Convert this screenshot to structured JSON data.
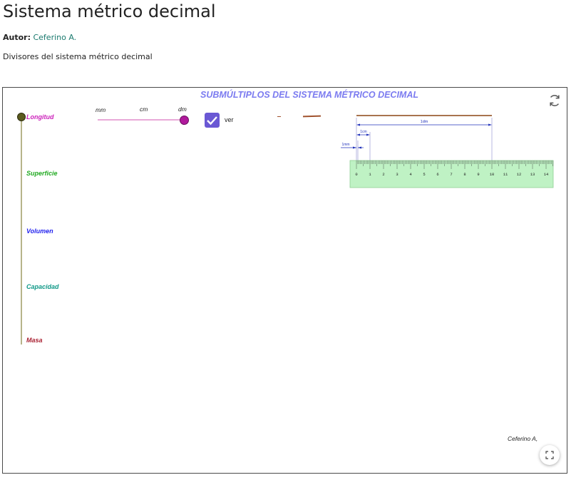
{
  "page": {
    "title": "Sistema métrico decimal",
    "author_label": "Autor:",
    "author_name": "Ceferino A.",
    "description": "Divisores del sistema métrico decimal"
  },
  "applet": {
    "heading": "SUBMÚLTIPLOS DEL SISTEMA MÉTRICO DECIMAL",
    "categories": [
      "Longitud",
      "Superficie",
      "Volumen",
      "Capacidad",
      "Masa"
    ],
    "selected_category": "Longitud",
    "slider": {
      "labels": [
        "mm",
        "cm",
        "dm"
      ],
      "selected": "dm"
    },
    "checkbox": {
      "label": "ver",
      "checked": true
    },
    "ruler": {
      "dim_labels": {
        "dm": "1dm",
        "cm": "1cm",
        "mm": "1mm"
      },
      "scale_labels": [
        "0",
        "1",
        "2",
        "3",
        "4",
        "5",
        "6",
        "7",
        "8",
        "9",
        "10",
        "11",
        "12",
        "13",
        "14"
      ]
    },
    "signature": "Ceferino A,",
    "icons": {
      "refresh": "refresh-icon",
      "fullscreen": "fullscreen-icon",
      "check": "check-icon"
    },
    "colors": {
      "longitud": "#cc22bb",
      "superficie": "#22aa22",
      "volumen": "#2222ee",
      "capacidad": "#119988",
      "masa": "#aa2233",
      "heading": "#7b7bf0",
      "checkbox": "#6a58d4"
    }
  }
}
